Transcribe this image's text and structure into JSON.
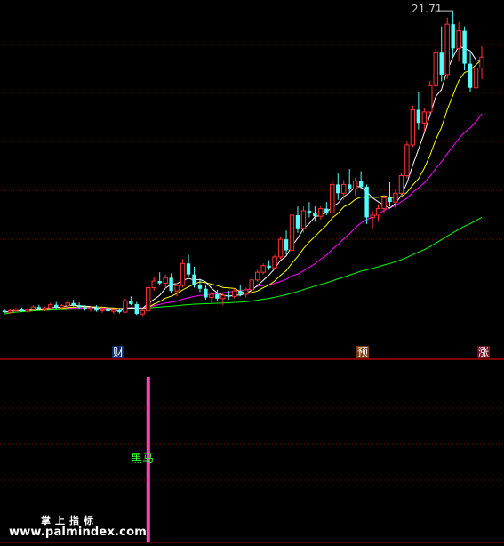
{
  "chart_data": {
    "type": "candlestick",
    "title": "",
    "high_label": "21.71",
    "ylim": [
      6.0,
      22.2
    ],
    "colors": {
      "up": "#ff3232",
      "down": "#54fcfc",
      "ma5": "#ffffff",
      "ma10": "#ffff00",
      "ma20": "#ff00ff",
      "ma60": "#00ff00",
      "grid": "#7f0000",
      "divider": "#ff0000",
      "signal_bar": "#ff40c0"
    },
    "candles": [
      [
        8.05,
        8.15,
        7.95,
        7.98
      ],
      [
        7.98,
        8.1,
        7.9,
        8.05
      ],
      [
        8.05,
        8.2,
        7.98,
        8.12
      ],
      [
        8.12,
        8.2,
        8.0,
        8.02
      ],
      [
        8.02,
        8.18,
        7.96,
        8.1
      ],
      [
        8.1,
        8.3,
        8.05,
        8.22
      ],
      [
        8.22,
        8.32,
        8.05,
        8.1
      ],
      [
        8.1,
        8.25,
        8.02,
        8.18
      ],
      [
        8.18,
        8.4,
        8.12,
        8.32
      ],
      [
        8.32,
        8.45,
        8.15,
        8.2
      ],
      [
        8.2,
        8.35,
        8.1,
        8.28
      ],
      [
        8.28,
        8.5,
        8.2,
        8.4
      ],
      [
        8.4,
        8.55,
        8.25,
        8.3
      ],
      [
        8.3,
        8.42,
        8.15,
        8.2
      ],
      [
        8.2,
        8.3,
        8.05,
        8.12
      ],
      [
        8.12,
        8.25,
        8.0,
        8.18
      ],
      [
        8.18,
        8.3,
        8.0,
        8.05
      ],
      [
        8.05,
        8.2,
        7.95,
        8.1
      ],
      [
        8.1,
        8.22,
        7.98,
        8.02
      ],
      [
        8.02,
        8.15,
        7.9,
        8.08
      ],
      [
        8.08,
        8.18,
        7.92,
        7.98
      ],
      [
        7.98,
        8.6,
        7.95,
        8.5
      ],
      [
        8.5,
        8.7,
        8.3,
        8.35
      ],
      [
        8.35,
        8.45,
        7.85,
        7.9
      ],
      [
        7.9,
        8.1,
        7.8,
        8.05
      ],
      [
        8.05,
        9.2,
        8.0,
        9.1
      ],
      [
        9.1,
        9.6,
        8.95,
        9.4
      ],
      [
        9.4,
        9.8,
        9.2,
        9.3
      ],
      [
        9.3,
        9.7,
        9.05,
        9.55
      ],
      [
        9.55,
        9.75,
        8.85,
        8.95
      ],
      [
        8.95,
        9.3,
        8.7,
        9.2
      ],
      [
        9.2,
        10.4,
        9.1,
        10.2
      ],
      [
        10.2,
        10.6,
        9.6,
        9.7
      ],
      [
        9.7,
        10.05,
        9.1,
        9.2
      ],
      [
        9.2,
        9.5,
        8.9,
        9.05
      ],
      [
        9.05,
        9.2,
        8.55,
        8.65
      ],
      [
        8.65,
        8.9,
        8.4,
        8.8
      ],
      [
        8.8,
        9.0,
        8.5,
        8.6
      ],
      [
        8.6,
        8.85,
        8.3,
        8.75
      ],
      [
        8.75,
        8.95,
        8.55,
        8.7
      ],
      [
        8.7,
        9.05,
        8.6,
        8.95
      ],
      [
        8.95,
        9.2,
        8.7,
        8.8
      ],
      [
        8.8,
        9.1,
        8.65,
        9.0
      ],
      [
        9.0,
        9.55,
        8.95,
        9.45
      ],
      [
        9.45,
        9.9,
        9.35,
        9.8
      ],
      [
        9.8,
        10.2,
        9.7,
        10.1
      ],
      [
        10.1,
        10.35,
        9.9,
        10.0
      ],
      [
        10.0,
        10.6,
        9.95,
        10.5
      ],
      [
        10.5,
        11.4,
        10.4,
        11.3
      ],
      [
        11.3,
        11.7,
        10.6,
        10.8
      ],
      [
        10.8,
        12.6,
        10.7,
        12.4
      ],
      [
        12.4,
        12.8,
        11.6,
        11.8
      ],
      [
        11.8,
        12.8,
        11.6,
        12.6
      ],
      [
        12.6,
        13.0,
        12.3,
        12.5
      ],
      [
        12.5,
        12.8,
        12.1,
        12.35
      ],
      [
        12.35,
        12.8,
        12.2,
        12.7
      ],
      [
        12.7,
        13.0,
        12.4,
        12.5
      ],
      [
        12.5,
        14.0,
        12.3,
        13.8
      ],
      [
        13.8,
        14.3,
        13.1,
        13.4
      ],
      [
        13.4,
        14.0,
        13.1,
        13.8
      ],
      [
        13.8,
        14.5,
        13.4,
        13.6
      ],
      [
        13.6,
        14.1,
        13.3,
        13.95
      ],
      [
        13.95,
        14.4,
        13.6,
        13.7
      ],
      [
        13.7,
        13.8,
        12.0,
        12.3
      ],
      [
        12.3,
        12.6,
        11.8,
        12.4
      ],
      [
        12.4,
        12.9,
        12.1,
        12.7
      ],
      [
        12.7,
        13.3,
        12.5,
        13.2
      ],
      [
        13.2,
        13.9,
        12.8,
        13.0
      ],
      [
        13.0,
        13.6,
        12.7,
        13.4
      ],
      [
        13.4,
        14.3,
        13.2,
        14.2
      ],
      [
        14.2,
        15.8,
        14.1,
        15.6
      ],
      [
        15.6,
        17.4,
        15.5,
        17.2
      ],
      [
        17.2,
        18.0,
        16.3,
        16.6
      ],
      [
        16.6,
        17.3,
        16.2,
        17.1
      ],
      [
        17.1,
        18.5,
        17.0,
        18.3
      ],
      [
        18.3,
        20.0,
        18.2,
        19.8
      ],
      [
        19.8,
        21.0,
        18.5,
        18.8
      ],
      [
        18.8,
        21.4,
        18.6,
        21.1
      ],
      [
        21.1,
        21.71,
        19.6,
        20.0
      ],
      [
        20.0,
        21.2,
        19.4,
        20.8
      ],
      [
        20.8,
        21.0,
        19.0,
        19.3
      ],
      [
        19.3,
        19.8,
        18.0,
        18.2
      ],
      [
        18.2,
        19.4,
        17.6,
        19.1
      ],
      [
        19.1,
        20.1,
        18.6,
        19.6
      ]
    ],
    "ma60": [
      7.9,
      7.95,
      7.98,
      8.0,
      8.02,
      8.04,
      8.06,
      8.07,
      8.08,
      8.09,
      8.1,
      8.11,
      8.12,
      8.12,
      8.13,
      8.13,
      8.13,
      8.14,
      8.14,
      8.14,
      8.14,
      8.15,
      8.15,
      8.15,
      8.16,
      8.18,
      8.2,
      8.22,
      8.24,
      8.26,
      8.28,
      8.31,
      8.33,
      8.35,
      8.36,
      8.37,
      8.38,
      8.39,
      8.4,
      8.41,
      8.43,
      8.44,
      8.46,
      8.49,
      8.53,
      8.57,
      8.61,
      8.66,
      8.72,
      8.78,
      8.85,
      8.93,
      9.01,
      9.09,
      9.17,
      9.25,
      9.32,
      9.41,
      9.5,
      9.58,
      9.67,
      9.76,
      9.85,
      9.91,
      9.98,
      10.05,
      10.13,
      10.2,
      10.28,
      10.37,
      10.48,
      10.61,
      10.72,
      10.83,
      10.97,
      11.13,
      11.28,
      11.45,
      11.6,
      11.76,
      11.9,
      12.02,
      12.16,
      12.3
    ]
  },
  "signal_panel": {
    "label": "黑马",
    "bar_index": 25,
    "bar_value": 1
  },
  "event_tags": [
    {
      "text": "财",
      "index": 25
    },
    {
      "text": "预",
      "index": 70
    },
    {
      "text": "涨",
      "index": 83
    }
  ],
  "branding": {
    "name": "掌上指标",
    "url": "www.palmindex.com"
  }
}
